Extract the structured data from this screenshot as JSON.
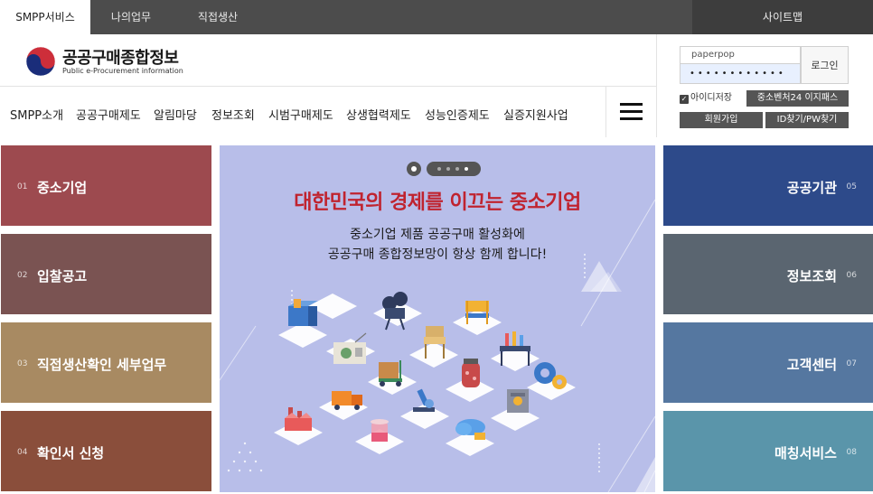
{
  "topbar": {
    "tabs": [
      {
        "label": "SMPP서비스",
        "active": true
      },
      {
        "label": "나의업무",
        "active": false
      },
      {
        "label": "직접생산",
        "active": false
      }
    ],
    "sitemap": "사이트맵"
  },
  "logo": {
    "title": "공공구매종합정보",
    "subtitle": "Public e-Procurement information"
  },
  "nav": {
    "items": [
      "SMPP소개",
      "공공구매제도",
      "알림마당",
      "정보조회",
      "시범구매제도",
      "상생협력제도",
      "성능인증제도",
      "실증지원사업"
    ],
    "menu_icon": "hamburger-menu-icon"
  },
  "login": {
    "id_value": "paperpop",
    "pw_value": "••••••••••••",
    "login_label": "로그인",
    "save_id_label": "아이디저장",
    "save_id_checked": true,
    "venture_label": "중소벤처24 이지패스",
    "join_label": "회원가입",
    "find_label": "ID찾기/PW찾기"
  },
  "left_tiles": [
    {
      "num": "01",
      "label": "중소기업",
      "color": "#9d4a4f"
    },
    {
      "num": "02",
      "label": "입찰공고",
      "color": "#7a5352"
    },
    {
      "num": "03",
      "label": "직접생산확인 세부업무",
      "color": "#a88a62"
    },
    {
      "num": "04",
      "label": "확인서 신청",
      "color": "#8a4e3b"
    }
  ],
  "banner": {
    "headline": "대한민국의 경제를 이끄는 중소기업",
    "line1": "중소기업 제품 공공구매 활성화에",
    "line2": "공공구매 종합정보망이 항상 함께 합니다!",
    "background": "#b8bee9",
    "headline_color": "#c0232f",
    "active_slide": 4,
    "slide_count": 4
  },
  "right_tiles": [
    {
      "num": "05",
      "label": "공공기관",
      "color": "#2d4a8a"
    },
    {
      "num": "06",
      "label": "정보조회",
      "color": "#5a6570"
    },
    {
      "num": "07",
      "label": "고객센터",
      "color": "#5577a0"
    },
    {
      "num": "08",
      "label": "매칭서비스",
      "color": "#5a95aa"
    }
  ]
}
